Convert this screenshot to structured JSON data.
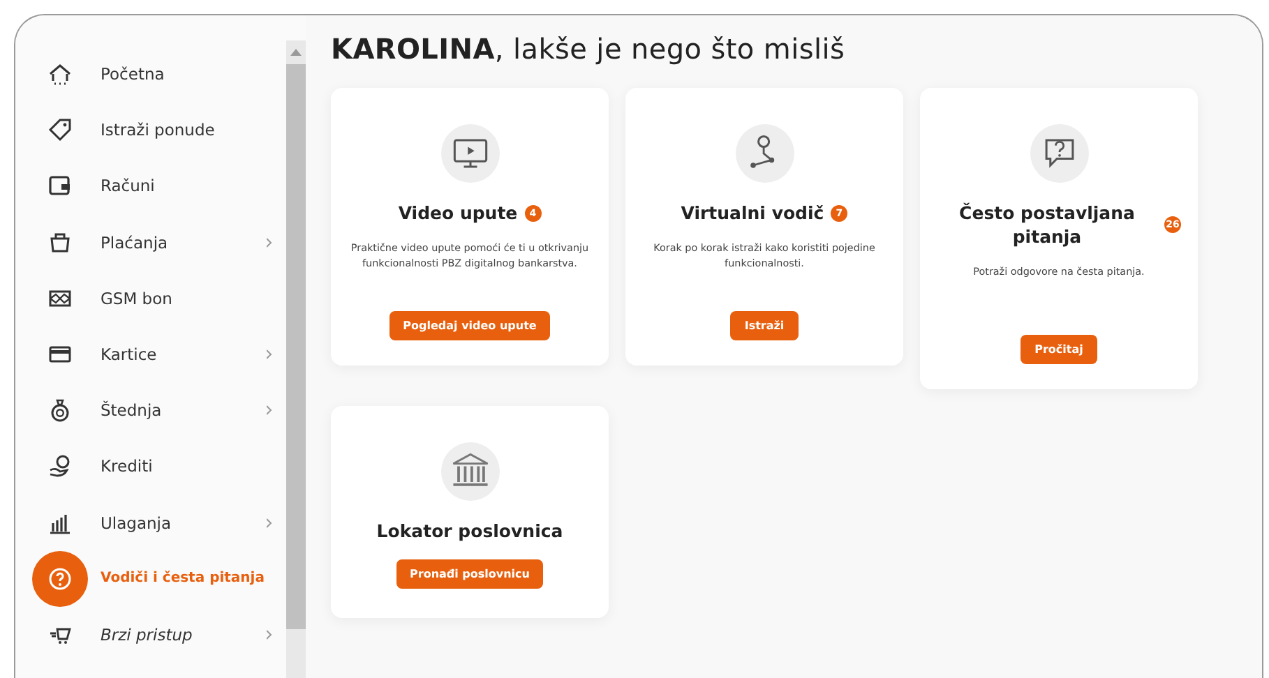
{
  "sidebar": {
    "items": [
      {
        "label": "Početna",
        "selected": false,
        "expandable": false,
        "kind": "nav"
      },
      {
        "label": "Istraži ponude",
        "selected": false,
        "expandable": false,
        "kind": "nav"
      },
      {
        "label": "Računi",
        "selected": false,
        "expandable": false,
        "kind": "nav"
      },
      {
        "label": "Plaćanja",
        "selected": false,
        "expandable": true,
        "kind": "nav"
      },
      {
        "label": "GSM bon",
        "selected": false,
        "expandable": false,
        "kind": "nav"
      },
      {
        "label": "Kartice",
        "selected": false,
        "expandable": true,
        "kind": "nav"
      },
      {
        "label": "Štednja",
        "selected": false,
        "expandable": true,
        "kind": "nav"
      },
      {
        "label": "Krediti",
        "selected": false,
        "expandable": false,
        "kind": "nav"
      },
      {
        "label": "Ulaganja",
        "selected": false,
        "expandable": true,
        "kind": "nav"
      },
      {
        "label": "Vodiči i česta pitanja",
        "selected": true,
        "expandable": false,
        "kind": "nav"
      },
      {
        "label": "Brzi pristup",
        "selected": false,
        "expandable": true,
        "kind": "quick"
      }
    ]
  },
  "heading": "**KAROLINA**, lakše je nego što misliš",
  "cards": [
    {
      "title": "Video upute",
      "badge": "4",
      "text": "Praktične video upute pomoći će ti u otkrivanju funkcionalnosti PBZ digitalnog bankarstva.",
      "button": "Pogledaj video upute"
    },
    {
      "title": "Virtualni vodič",
      "badge": "7",
      "text": "Korak po korak istraži kako koristiti pojedine funkcionalnosti.",
      "button": "Istraži"
    },
    {
      "title": "Često postavljana pitanja",
      "badge": "26",
      "text": "Potraži odgovore na česta pitanja.",
      "button": "Pročitaj"
    },
    {
      "title": "Lokator poslovnica",
      "button": "Pronađi poslovnicu"
    }
  ]
}
